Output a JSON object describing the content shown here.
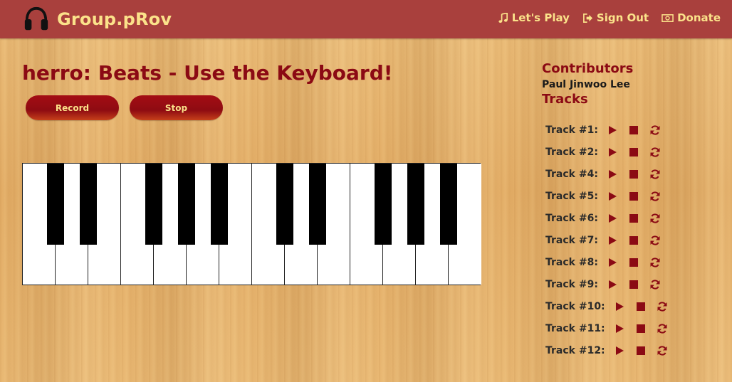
{
  "header": {
    "brand": "Group.pRov",
    "nav": {
      "play": "Let's Play",
      "signout": "Sign Out",
      "donate": "Donate"
    }
  },
  "main": {
    "title": "herro: Beats - Use the Keyboard!",
    "record_label": "Record",
    "stop_label": "Stop"
  },
  "sidebar": {
    "contributors_heading": "Contributors",
    "contributor": "Paul Jinwoo Lee",
    "tracks_heading": "Tracks",
    "tracks": [
      "Track #1:",
      "Track #2:",
      "Track #4:",
      "Track #5:",
      "Track #6:",
      "Track #7:",
      "Track #8:",
      "Track #9:",
      "Track #10:",
      "Track #11:",
      "Track #12:"
    ]
  },
  "icons": {
    "brand": "headphones-icon",
    "play_nav": "music-note-icon",
    "signout": "sign-out-icon",
    "donate": "money-icon",
    "track_play": "play-icon",
    "track_stop": "stop-icon",
    "track_loop": "refresh-icon"
  },
  "colors": {
    "header_bg": "#a9403d",
    "header_text": "#fbe28a",
    "accent": "#8b0a14"
  }
}
